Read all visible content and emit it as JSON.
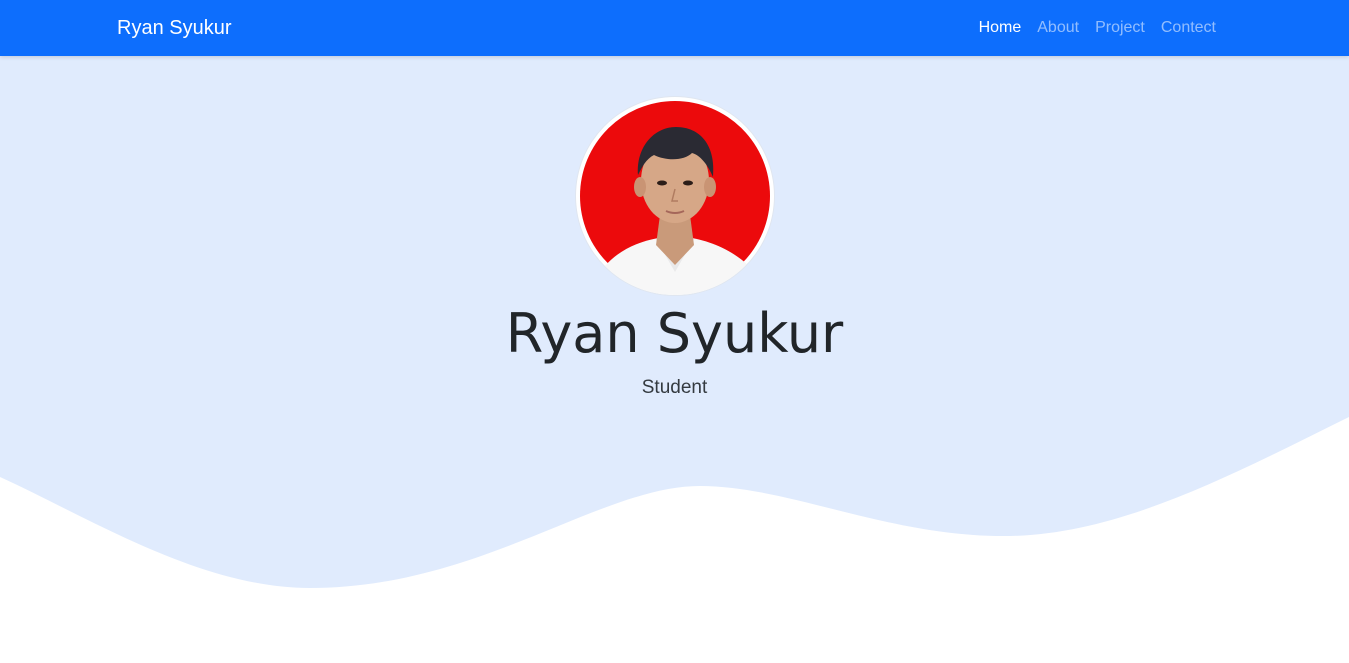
{
  "navbar": {
    "brand": "Ryan Syukur",
    "links": [
      {
        "label": "Home",
        "active": true
      },
      {
        "label": "About",
        "active": false
      },
      {
        "label": "Project",
        "active": false
      },
      {
        "label": "Contect",
        "active": false
      }
    ]
  },
  "hero": {
    "name": "Ryan Syukur",
    "subtitle": "Student"
  },
  "colors": {
    "navbar": "#0d6efd",
    "hero_background": "#e0ebfd",
    "page_background": "#ffffff",
    "avatar_background": "#ec0a0c"
  },
  "icons": {
    "avatar": "profile-photo"
  }
}
